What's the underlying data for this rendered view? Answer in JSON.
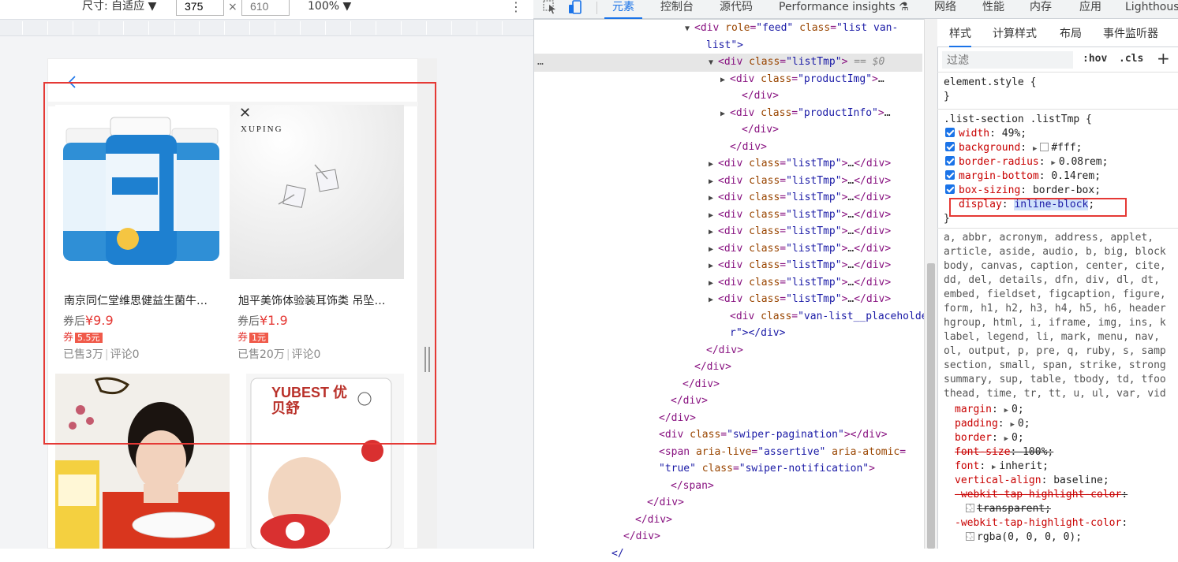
{
  "devbar": {
    "size_label": "尺寸: 自适应 ▼",
    "width": "375",
    "times": "×",
    "height_placeholder": "610",
    "zoom": "100% ▼",
    "more": "⋮"
  },
  "products": [
    {
      "name": "南京同仁堂维思健益生菌牛…",
      "price_prefix": "券后",
      "price": "¥9.9",
      "coupon_prefix": "券",
      "coupon": "5.5元",
      "sold": "已售3万",
      "comments": "评论0",
      "img_brand": ""
    },
    {
      "name": "旭平美饰体验装耳饰类 吊坠…",
      "price_prefix": "券后",
      "price": "¥1.9",
      "coupon_prefix": "券",
      "coupon": "1元",
      "sold": "已售20万",
      "comments": "评论0",
      "img_brand": "XUPING"
    },
    {
      "img_brand": ""
    },
    {
      "img_brand": "YUBEST 优贝舒"
    }
  ],
  "devtools": {
    "tabs": [
      {
        "label": "元素",
        "active": true
      },
      {
        "label": "控制台"
      },
      {
        "label": "源代码"
      },
      {
        "label": "Performance insights ⚗"
      },
      {
        "label": "网络"
      },
      {
        "label": "性能"
      },
      {
        "label": "内存"
      },
      {
        "label": "应用"
      },
      {
        "label": "Lighthouse"
      }
    ],
    "dom_lines": [
      {
        "indent": 13,
        "tri": "▼",
        "html": "<div role=\"feed\" class=\"list van-"
      },
      {
        "indent": 14,
        "tri": "",
        "html": "list\">"
      },
      {
        "indent": 15,
        "tri": "▼",
        "html": "<div class=\"listTmp\"> == $0",
        "selected": true
      },
      {
        "indent": 16,
        "tri": "▶",
        "html": "<div class=\"productImg\">…"
      },
      {
        "indent": 17,
        "tri": "",
        "html": "</div>"
      },
      {
        "indent": 16,
        "tri": "▶",
        "html": "<div class=\"productInfo\">…"
      },
      {
        "indent": 17,
        "tri": "",
        "html": "</div>"
      },
      {
        "indent": 16,
        "tri": "",
        "html": "</div>"
      },
      {
        "indent": 15,
        "tri": "▶",
        "html": "<div class=\"listTmp\">…</div>"
      },
      {
        "indent": 15,
        "tri": "▶",
        "html": "<div class=\"listTmp\">…</div>"
      },
      {
        "indent": 15,
        "tri": "▶",
        "html": "<div class=\"listTmp\">…</div>"
      },
      {
        "indent": 15,
        "tri": "▶",
        "html": "<div class=\"listTmp\">…</div>"
      },
      {
        "indent": 15,
        "tri": "▶",
        "html": "<div class=\"listTmp\">…</div>"
      },
      {
        "indent": 15,
        "tri": "▶",
        "html": "<div class=\"listTmp\">…</div>"
      },
      {
        "indent": 15,
        "tri": "▶",
        "html": "<div class=\"listTmp\">…</div>"
      },
      {
        "indent": 15,
        "tri": "▶",
        "html": "<div class=\"listTmp\">…</div>"
      },
      {
        "indent": 15,
        "tri": "▶",
        "html": "<div class=\"listTmp\">…</div>"
      },
      {
        "indent": 16,
        "tri": "",
        "html": "<div class=\"van-list__placeholde"
      },
      {
        "indent": 16,
        "tri": "",
        "html": "r\"></div>"
      },
      {
        "indent": 14,
        "tri": "",
        "html": "</div>"
      },
      {
        "indent": 13,
        "tri": "",
        "html": "</div>"
      },
      {
        "indent": 12,
        "tri": "",
        "html": "</div>"
      },
      {
        "indent": 11,
        "tri": "",
        "html": "</div>"
      },
      {
        "indent": 10,
        "tri": "",
        "html": "</div>"
      },
      {
        "indent": 10,
        "tri": "",
        "html": "<div class=\"swiper-pagination\"></div>"
      },
      {
        "indent": 10,
        "tri": "",
        "html": "<span aria-live=\"assertive\" aria-atomic="
      },
      {
        "indent": 10,
        "tri": "",
        "html": "\"true\" class=\"swiper-notification\">"
      },
      {
        "indent": 11,
        "tri": "",
        "html": "</span>"
      },
      {
        "indent": 9,
        "tri": "",
        "html": "</div>"
      },
      {
        "indent": 8,
        "tri": "",
        "html": "</div>"
      },
      {
        "indent": 7,
        "tri": "",
        "html": "</div>"
      },
      {
        "indent": 6,
        "tri": "",
        "html": "</"
      }
    ],
    "gutter_dots": "…"
  },
  "styles": {
    "tabs": [
      "样式",
      "计算样式",
      "布局",
      "事件监听器"
    ],
    "filter_placeholder": "过滤",
    "hov": ":hov",
    "cls": ".cls",
    "plus": "+",
    "element_style": "element.style {",
    "close": "}",
    "rule_selector": ".list-section .listTmp {",
    "rule_props": [
      {
        "prop": "width",
        "val": "49%;"
      },
      {
        "prop": "background",
        "val": "#fff;",
        "arrow": true,
        "swatch": true
      },
      {
        "prop": "border-radius",
        "val": "0.08rem;",
        "arrow": true
      },
      {
        "prop": "margin-bottom",
        "val": "0.14rem;"
      },
      {
        "prop": "box-sizing",
        "val": "border-box;"
      },
      {
        "prop": "display",
        "val": "inline-block",
        "nocheck": true,
        "highlight": true
      }
    ],
    "ua_selectors": [
      "a, abbr, acronym, address, applet,",
      "article, aside, audio, b, big, block",
      "body, canvas, caption, center, cite,",
      "dd, del, details, dfn, div, dl, dt,",
      "embed, fieldset, figcaption, figure,",
      "form, h1, h2, h3, h4, h5, h6, header",
      "hgroup, html, i, iframe, img, ins, k",
      "label, legend, li, mark, menu, nav,",
      "ol, output, p, pre, q, ruby, s, samp",
      "section, small, span, strike, strong",
      "summary, sup, table, tbody, td, tfoo",
      "thead, time, tr, tt, u, ul, var, vid"
    ],
    "ua_props": [
      {
        "prop": "margin",
        "val": "0;",
        "arrow": true
      },
      {
        "prop": "padding",
        "val": "0;",
        "arrow": true
      },
      {
        "prop": "border",
        "val": "0;",
        "arrow": true
      },
      {
        "prop": "font-size",
        "val": "100%;",
        "strike": true
      },
      {
        "prop": "font",
        "val": "inherit;",
        "arrow": true
      },
      {
        "prop": "vertical-align",
        "val": "baseline;"
      },
      {
        "prop": "-webkit-tap-highlight-color",
        "val": "",
        "strike": true
      },
      {
        "prop": "",
        "val": "transparent;",
        "strike": true,
        "swatch": "t",
        "sub": true
      },
      {
        "prop": "-webkit-tap-highlight-color",
        "val": ""
      },
      {
        "prop": "",
        "val": "rgba(0, 0, 0, 0);",
        "swatch": "t",
        "sub": true
      }
    ]
  },
  "colors": {
    "accent": "#1a73e8",
    "highlight_box": "#e53935",
    "price": "#e53935"
  }
}
